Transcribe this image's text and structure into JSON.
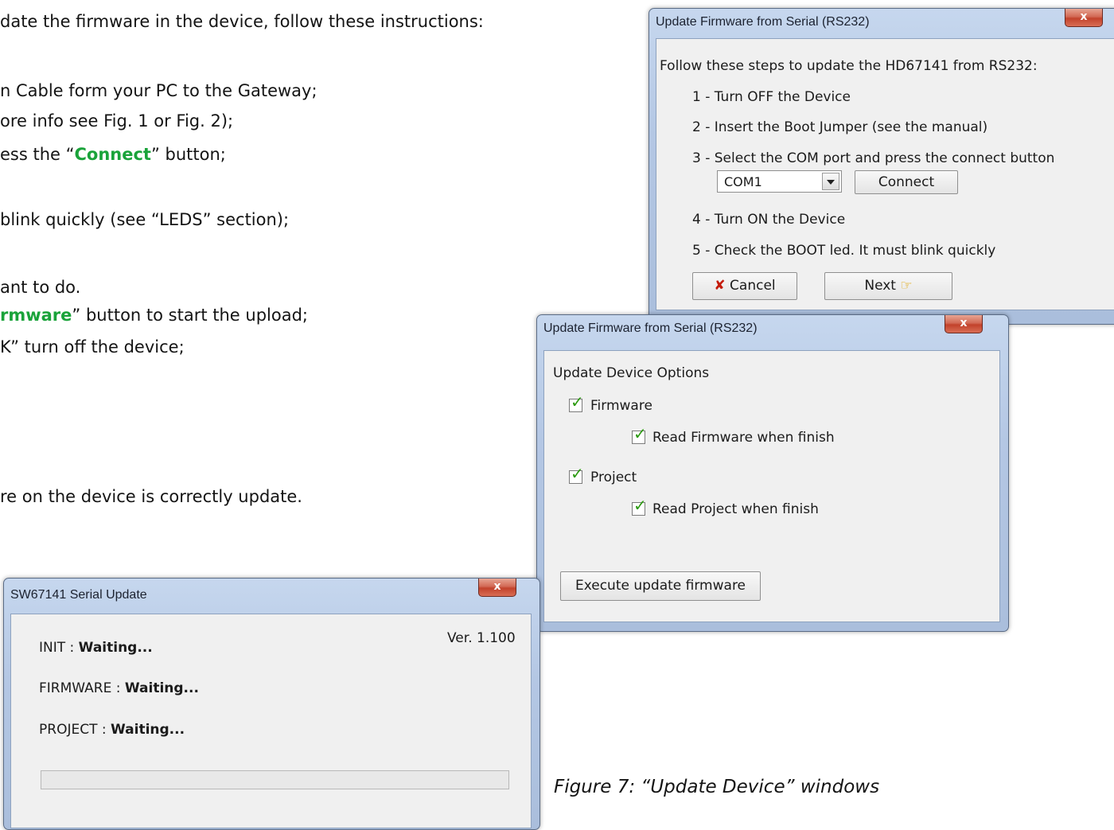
{
  "doc": {
    "lines": [
      {
        "pre": "date the firmware in the device, follow these instructions:",
        "hl": "",
        "post": ""
      },
      {
        "pre": "n Cable form your PC to the Gateway;",
        "hl": "",
        "post": ""
      },
      {
        "pre": "ore info see Fig. 1 or Fig. 2);",
        "hl": "",
        "post": ""
      },
      {
        "pre": "ess the “",
        "hl": "Connect",
        "post": "” button;"
      },
      {
        "pre": "blink quickly (see “LEDS” section);",
        "hl": "",
        "post": ""
      },
      {
        "pre": "ant to do.",
        "hl": "",
        "post": ""
      },
      {
        "pre": "",
        "hl": "rmware",
        "post": "” button to start the upload;"
      },
      {
        "pre": "K” turn off the device;",
        "hl": "",
        "post": ""
      },
      {
        "pre": "re on the device is correctly update.",
        "hl": "",
        "post": ""
      }
    ],
    "caption": "Figure 7: “Update Device” windows"
  },
  "dialog1": {
    "title": "Update Firmware from Serial (RS232)",
    "close_label": "x",
    "intro": "Follow these steps to update the HD67141 from RS232:",
    "step1": "1 - Turn OFF the Device",
    "step2": "2 - Insert the Boot Jumper (see the manual)",
    "step3": "3 - Select the  COM port and press the connect button",
    "com_value": "COM1",
    "connect_label": "Connect",
    "step4": "4 - Turn ON the Device",
    "step5": "5 - Check the BOOT led. It must blink quickly",
    "cancel_icon": "✘",
    "cancel_label": "Cancel",
    "next_label": "Next",
    "next_icon": "☞"
  },
  "dialog2": {
    "title": "Update Firmware from Serial (RS232)",
    "close_label": "x",
    "section": "Update Device Options",
    "firmware_label": "Firmware",
    "read_firmware_label": "Read Firmware when finish",
    "project_label": "Project",
    "read_project_label": "Read Project when finish",
    "execute_label": "Execute update firmware",
    "firmware_checked": true,
    "read_firmware_checked": true,
    "project_checked": true,
    "read_project_checked": true
  },
  "dialog3": {
    "title": "SW67141 Serial Update",
    "close_label": "x",
    "version": "Ver. 1.100",
    "init_label": "INIT : ",
    "init_status": "Waiting...",
    "firmware_label": "FIRMWARE : ",
    "firmware_status": "Waiting...",
    "project_label": "PROJECT : ",
    "project_status": "Waiting...",
    "progress": 0
  }
}
